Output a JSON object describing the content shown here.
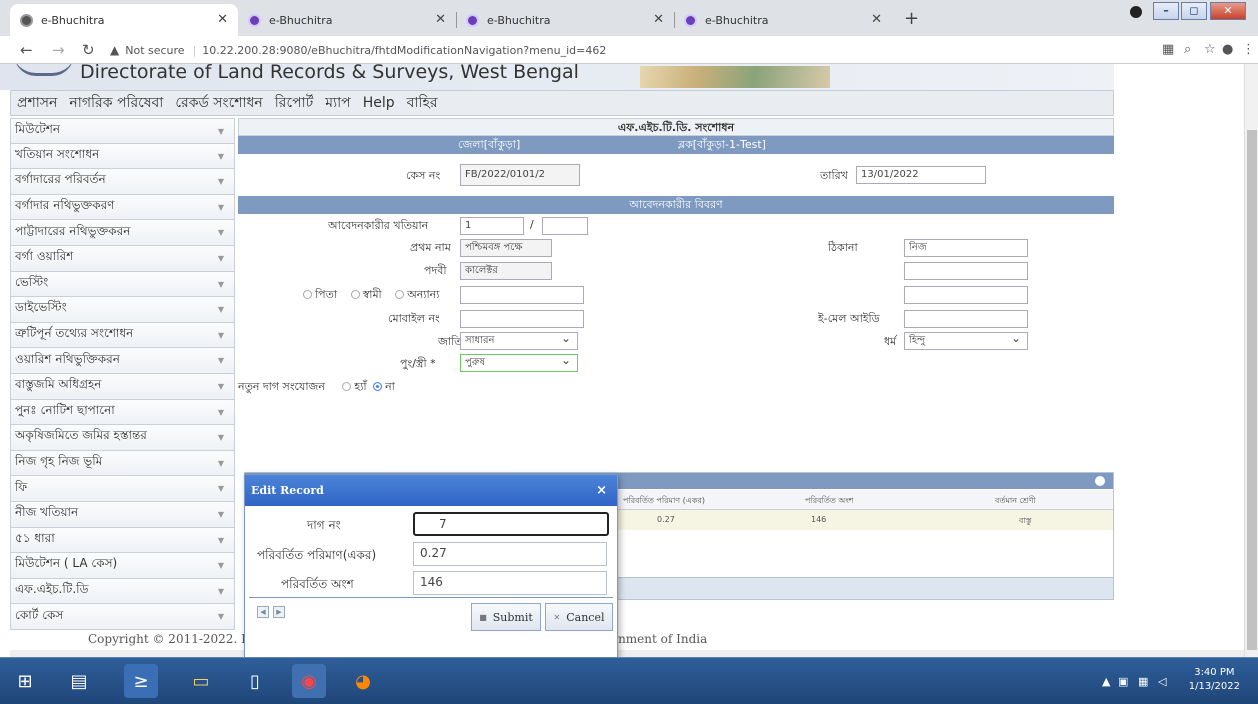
{
  "browser": {
    "tabs": [
      {
        "title": "e-Bhuchitra",
        "active": true
      },
      {
        "title": "e-Bhuchitra",
        "active": false
      },
      {
        "title": "e-Bhuchitra",
        "active": false
      },
      {
        "title": "e-Bhuchitra",
        "active": false
      }
    ],
    "new_tab": "+",
    "not_secure": "Not secure",
    "url": "10.22.200.28:9080/eBhuchitra/fhtdModificationNavigation?menu_id=462"
  },
  "page": {
    "banner_title": "Directorate of Land Records & Surveys, West Bengal",
    "menu": [
      "প্রশাসন",
      "নাগরিক পরিষেবা",
      "রেকর্ড সংশোধন",
      "রিপোর্ট",
      "ম্যাপ",
      "Help",
      "বাহির"
    ],
    "sidebar": [
      "মিউটেশন",
      "খতিয়ান সংশোধন",
      "বর্গাদারের পরিবর্তন",
      "বর্গাদার নথিভুক্তকরণ",
      "পাট্টাদারের নথিভুক্তকরন",
      "বর্গা ওয়ারিশ",
      "ভেস্টিং",
      "ডাইভেস্টিং",
      "ত্রুটিপূর্ন তথ্যের সংশোধন",
      "ওয়ারিশ নথিভুক্তিকরন",
      "বাস্তুজমি অধিগ্রহন",
      "পুনঃ নোটিশ ছাপানো",
      "অকৃষিজমিতে জমির হস্তান্তর",
      "নিজ গৃহ নিজ ভূমি",
      "ফি",
      "নীজ খতিয়ান",
      "৫১ ধারা",
      "মিউটেশন ( LA কেস)",
      "এফ.এইচ.টি.ডি",
      "কোর্ট কেস"
    ],
    "form": {
      "section_title": "এফ.এইচ.টি.ডি. সংশোধন",
      "district": "জেলা[বাঁকুড়া]",
      "block": "ব্লক[বাঁকুড়া-1-Test]",
      "case_label": "কেস নং",
      "case_value": "FB/2022/0101/2",
      "date_label": "তারিখ",
      "date_value": "13/01/2022",
      "applicant_title": "আবেদনকারীর বিবরণ",
      "khatian_label": "আবেদনকারীর খতিয়ান",
      "khatian_value": "1",
      "khatian_sep": "/",
      "first_name_label": "প্রথম নাম",
      "first_name_value": "পশ্চিমবঙ্গ পক্ষে",
      "title_label": "পদবী",
      "title_value": "কালেক্টর",
      "relation_options": [
        "পিতা",
        "স্বামী",
        "অন্যান্য"
      ],
      "mobile_label": "মোবাইল নং",
      "caste_label": "জাতি",
      "caste_value": "সাধারন",
      "gender_label": "পুং/স্ত্রী *",
      "gender_value": "পুরুষ",
      "address_label": "ঠিকানা",
      "address_value": "নিজ",
      "email_label": "ই-মেল আইডি",
      "religion_label": "ধর্ম",
      "religion_value": "হিন্দু",
      "new_plot_label": "নতুন দাগ সংযোজন",
      "yes": "হ্যাঁ",
      "no": "না"
    },
    "grid": {
      "columns": [
        "পরিবর্তিত পরিমাণ (একর)",
        "পরিবর্তিত অংশ",
        "বর্তমান শ্রেণী"
      ],
      "row": [
        "0.27",
        "146",
        "বাস্তু"
      ]
    },
    "copyright": "Copyright © 2011-2022. Designed & Developed by National Informatics Centre, Government of India"
  },
  "dialog": {
    "title": "Edit Record",
    "close": "×",
    "plot_label": "দাগ নং",
    "plot_value": "7",
    "area_label": "পরিবর্তিত পরিমাণ(একর)",
    "area_value": "0.27",
    "share_label": "পরিবর্তিত অংশ",
    "share_value": "146",
    "submit": "Submit",
    "cancel": "Cancel"
  },
  "taskbar": {
    "time": "3:40 PM",
    "date": "1/13/2022"
  }
}
